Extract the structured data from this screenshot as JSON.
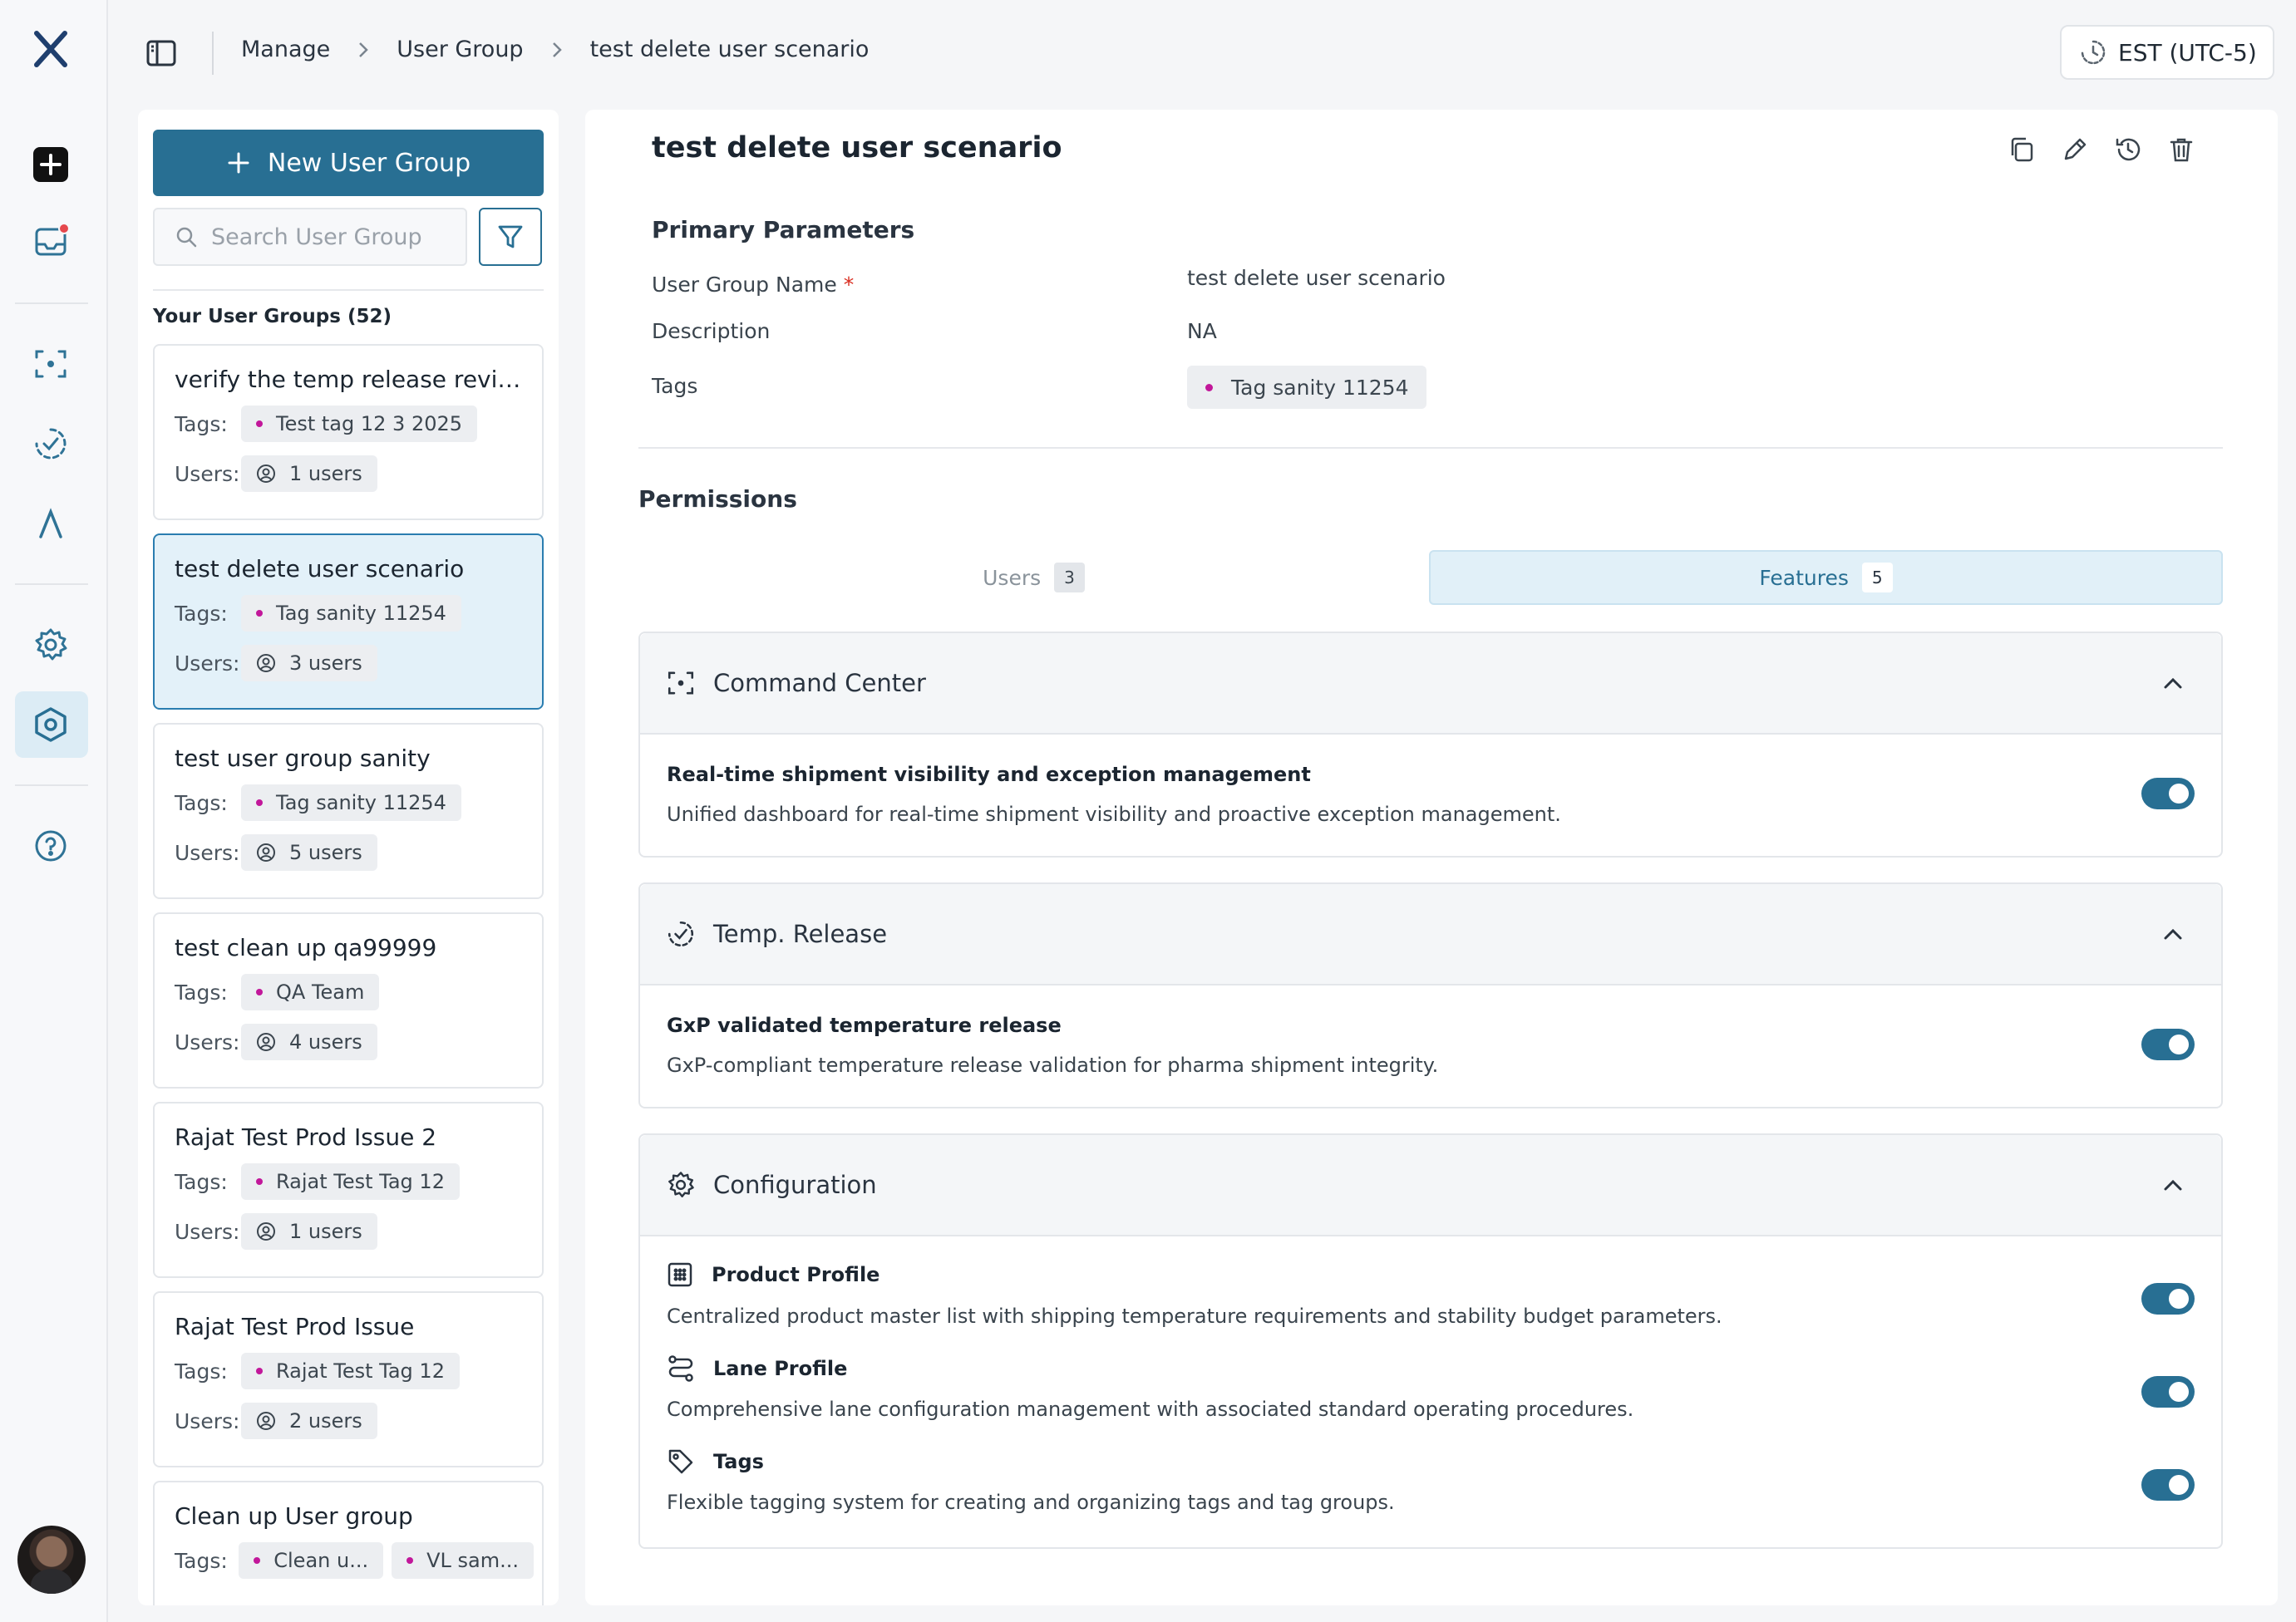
{
  "app": {
    "logo": "X"
  },
  "rail": {
    "icons": [
      "plus-square-icon",
      "inbox-icon",
      "scan-icon",
      "check-circle-icon",
      "lambda-icon",
      "gear-icon",
      "settings-hex-icon",
      "help-icon"
    ],
    "notification_badge_color": "#e5484d",
    "accent": "#286f93"
  },
  "breadcrumb": {
    "items": [
      "Manage",
      "User Group",
      "test delete user scenario"
    ]
  },
  "timezone": {
    "label": "EST (UTC-5)"
  },
  "list": {
    "new_button": "New User Group",
    "search_placeholder": "Search User Group",
    "heading": "Your User Groups (52)",
    "tags_label": "Tags:",
    "users_label": "Users:",
    "cards": [
      {
        "title": "verify the temp release review...",
        "tags": [
          "Test tag 12 3 2025"
        ],
        "users": "1 users",
        "active": false
      },
      {
        "title": "test delete user scenario",
        "tags": [
          "Tag sanity 11254"
        ],
        "users": "3 users",
        "active": true
      },
      {
        "title": "test user group sanity",
        "tags": [
          "Tag sanity 11254"
        ],
        "users": "5 users",
        "active": false
      },
      {
        "title": "test clean up qa99999",
        "tags": [
          "QA Team"
        ],
        "users": "4 users",
        "active": false
      },
      {
        "title": "Rajat Test Prod Issue 2",
        "tags": [
          "Rajat Test Tag 12"
        ],
        "users": "1 users",
        "active": false
      },
      {
        "title": "Rajat Test Prod Issue",
        "tags": [
          "Rajat Test Tag 12"
        ],
        "users": "2 users",
        "active": false
      },
      {
        "title": "Clean up User group",
        "tags": [
          "Clean u...",
          "VL sam..."
        ],
        "users": "",
        "active": false
      }
    ]
  },
  "detail": {
    "title": "test delete user scenario",
    "actions": [
      "copy-icon",
      "edit-icon",
      "history-icon",
      "delete-icon"
    ],
    "primary_heading": "Primary Parameters",
    "fields": {
      "name_label": "User Group Name",
      "required_mark": "*",
      "name_value": "test delete user scenario",
      "description_label": "Description",
      "description_value": "NA",
      "tags_label": "Tags",
      "tag_value": "Tag sanity 11254"
    },
    "permissions_heading": "Permissions",
    "tabs": [
      {
        "label": "Users",
        "count": "3",
        "active": false
      },
      {
        "label": "Features",
        "count": "5",
        "active": true
      }
    ],
    "groups": [
      {
        "name": "Command Center",
        "icon": "scan-icon",
        "features": [
          {
            "name": "Real-time shipment visibility and exception management",
            "desc": "Unified dashboard for real-time shipment visibility and proactive exception management.",
            "enabled": true
          }
        ]
      },
      {
        "name": "Temp. Release",
        "icon": "check-circle-icon",
        "features": [
          {
            "name": "GxP validated temperature release",
            "desc": "GxP-compliant temperature release validation for pharma shipment integrity.",
            "enabled": true
          }
        ]
      },
      {
        "name": "Configuration",
        "icon": "gear-icon",
        "features": [
          {
            "name": "Product Profile",
            "icon": "grid-icon",
            "desc": "Centralized product master list with shipping temperature requirements and stability budget parameters.",
            "enabled": true
          },
          {
            "name": "Lane Profile",
            "icon": "route-icon",
            "desc": "Comprehensive lane configuration management with associated standard operating procedures.",
            "enabled": true
          },
          {
            "name": "Tags",
            "icon": "tag-icon",
            "desc": "Flexible tagging system for creating and organizing tags and tag groups.",
            "enabled": true
          }
        ]
      }
    ]
  }
}
